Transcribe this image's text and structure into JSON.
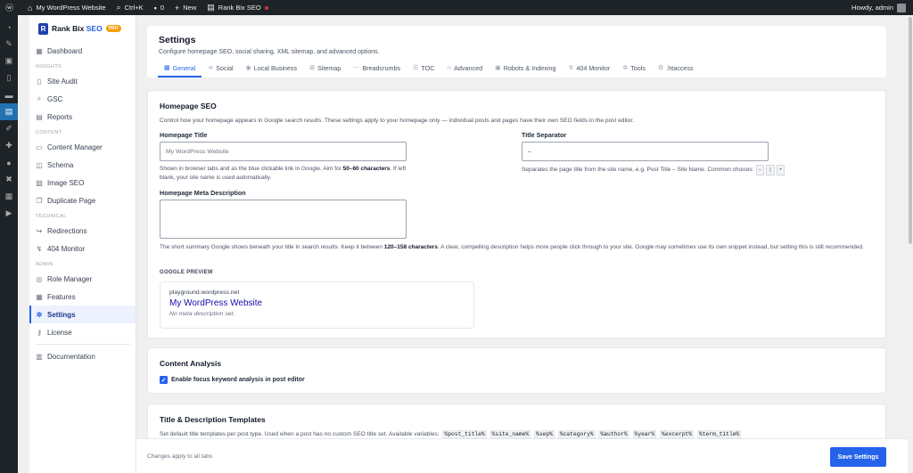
{
  "adminbar": {
    "wp_icon": "wordpress-logo-icon",
    "site_name": "My WordPress Website",
    "shortcut": "Ctrl+K",
    "comments_count": "0",
    "new_label": "New",
    "plugin_label": "Rank Bix SEO",
    "howdy": "Howdy, admin"
  },
  "wpmenu": {
    "icons": [
      "dashboard-icon",
      "pin-icon",
      "media-icon",
      "pages-icon",
      "comments-icon",
      "seo-plugin-icon",
      "appearance-icon",
      "plugins-icon",
      "users-icon",
      "tools-icon",
      "settings-icon",
      "play-icon"
    ],
    "active_index": 5
  },
  "brand": {
    "name": "Rank Bix",
    "seo": "SEO",
    "badge": "PRO",
    "logo_letter": "R"
  },
  "nav": {
    "dashboard": "Dashboard",
    "insights_label": "INSIGHTS",
    "site_audit": "Site Audit",
    "gsc": "GSC",
    "reports": "Reports",
    "content_label": "CONTENT",
    "content_manager": "Content Manager",
    "schema": "Schema",
    "image_seo": "Image SEO",
    "duplicate_page": "Duplicate Page",
    "technical_label": "TECHNICAL",
    "redirections": "Redirections",
    "monitor_404": "404 Monitor",
    "admin_label": "ADMIN",
    "role_manager": "Role Manager",
    "features": "Features",
    "settings": "Settings",
    "license": "License",
    "documentation": "Documentation"
  },
  "header": {
    "title": "Settings",
    "subtitle": "Configure homepage SEO, social sharing, XML sitemap, and advanced options.",
    "tabs": [
      "General",
      "Social",
      "Local Business",
      "Sitemap",
      "Breadcrumbs",
      "TOC",
      "Advanced",
      "Robots & Indexing",
      "404 Monitor",
      "Tools",
      ".htaccess"
    ]
  },
  "homepage_seo": {
    "title": "Homepage SEO",
    "description": "Control how your homepage appears in Google search results. These settings apply to your homepage only — individual posts and pages have their own SEO fields in the post editor.",
    "title_label": "Homepage Title",
    "title_placeholder": "My WordPress Website",
    "title_help_1": "Shown in browser tabs and as the blue clickable link in Google. Aim for ",
    "title_help_bold": "50–60 characters",
    "title_help_2": ". If left blank, your site name is used automatically.",
    "sep_label": "Title Separator",
    "sep_value": "–",
    "sep_help": "Separates the page title from the site name, e.g. Post Title – Site Name. Common choices:",
    "sep_choices": [
      "–",
      "|",
      "•"
    ],
    "meta_label": "Homepage Meta Description",
    "meta_value": "",
    "meta_help_1": "The short summary Google shows beneath your title in search results. Keep it between ",
    "meta_help_bold": "120–158 characters",
    "meta_help_2": ". A clear, compelling description helps more people click through to your site. Google may sometimes use its own snippet instead, but setting this is still recommended.",
    "preview_label": "GOOGLE PREVIEW",
    "preview_url": "playground.wordpress.net",
    "preview_title": "My WordPress Website",
    "preview_desc": "No meta description set."
  },
  "content_analysis": {
    "title": "Content Analysis",
    "checkbox_label": "Enable focus keyword analysis in post editor",
    "checked": true
  },
  "templates": {
    "title": "Title & Description Templates",
    "description": "Set default title templates per post type. Used when a post has no custom SEO title set. Available variables:",
    "variables": [
      "%post_title%",
      "%site_name%",
      "%sep%",
      "%category%",
      "%author%",
      "%year%",
      "%excerpt%",
      "%term_title%"
    ]
  },
  "footer": {
    "note": "Changes apply to all tabs",
    "save_label": "Save Settings"
  }
}
